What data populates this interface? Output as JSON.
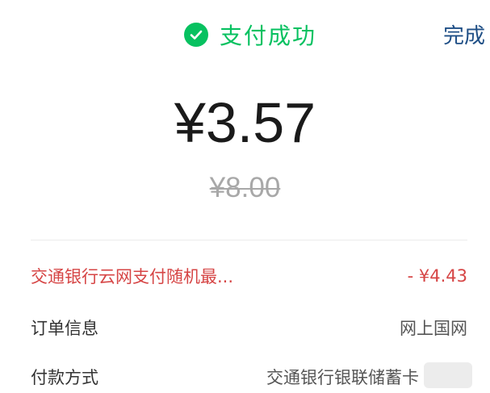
{
  "header": {
    "status_text": "支付成功",
    "done_label": "完成"
  },
  "payment": {
    "amount": "¥3.57",
    "original_amount": "¥8.00"
  },
  "rows": {
    "discount": {
      "label": "交通银行云网支付随机最...",
      "value": "- ¥4.43"
    },
    "order": {
      "label": "订单信息",
      "value": "网上国网"
    },
    "method": {
      "label": "付款方式",
      "value": "交通银行银联储蓄卡"
    }
  },
  "colors": {
    "success": "#07c160",
    "discount": "#d64545",
    "link": "#1f4f86"
  },
  "icons": {
    "status": "check-circle-icon"
  }
}
